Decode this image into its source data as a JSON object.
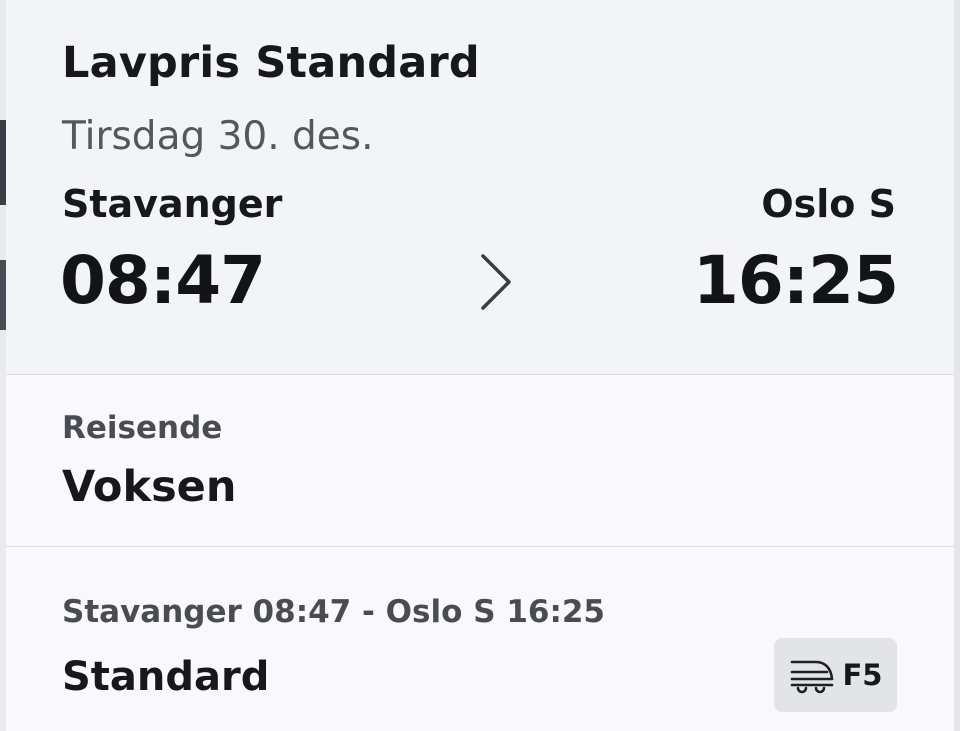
{
  "ticket": {
    "type": "Lavpris Standard",
    "date": "Tirsdag 30. des.",
    "origin": "Stavanger",
    "destination": "Oslo S",
    "departure": "08:47",
    "arrival": "16:25"
  },
  "travelers": {
    "label": "Reisende",
    "value": "Voksen"
  },
  "leg": {
    "route": "Stavanger 08:47 - Oslo S 16:25",
    "class": "Standard",
    "line": "F5",
    "icon": "train-icon"
  },
  "colors": {
    "card_top": "#f3f4f7",
    "card": "#f9f9fb",
    "badge": "#e3e4e8",
    "text": "#17181b",
    "muted": "#55575e"
  }
}
